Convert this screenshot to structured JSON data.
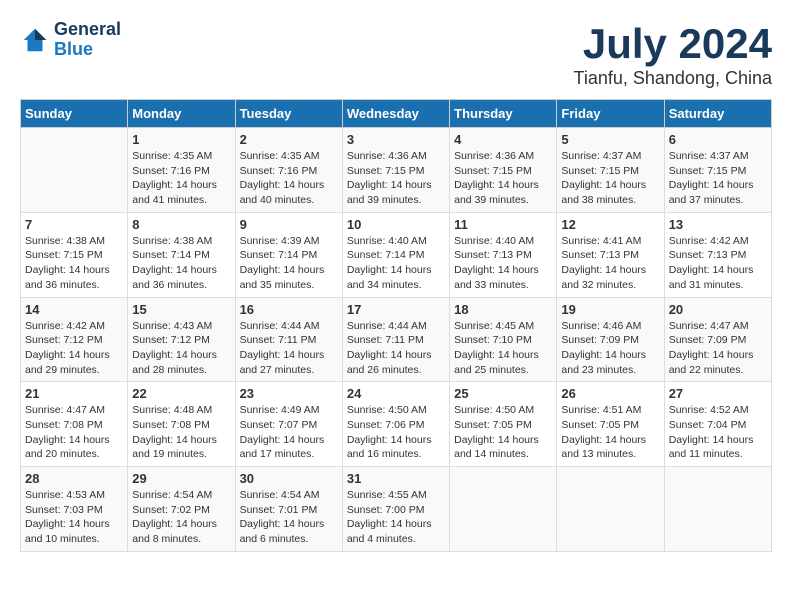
{
  "header": {
    "logo_line1": "General",
    "logo_line2": "Blue",
    "title": "July 2024",
    "subtitle": "Tianfu, Shandong, China"
  },
  "days_of_week": [
    "Sunday",
    "Monday",
    "Tuesday",
    "Wednesday",
    "Thursday",
    "Friday",
    "Saturday"
  ],
  "weeks": [
    [
      {
        "day": "",
        "info": ""
      },
      {
        "day": "1",
        "info": "Sunrise: 4:35 AM\nSunset: 7:16 PM\nDaylight: 14 hours\nand 41 minutes."
      },
      {
        "day": "2",
        "info": "Sunrise: 4:35 AM\nSunset: 7:16 PM\nDaylight: 14 hours\nand 40 minutes."
      },
      {
        "day": "3",
        "info": "Sunrise: 4:36 AM\nSunset: 7:15 PM\nDaylight: 14 hours\nand 39 minutes."
      },
      {
        "day": "4",
        "info": "Sunrise: 4:36 AM\nSunset: 7:15 PM\nDaylight: 14 hours\nand 39 minutes."
      },
      {
        "day": "5",
        "info": "Sunrise: 4:37 AM\nSunset: 7:15 PM\nDaylight: 14 hours\nand 38 minutes."
      },
      {
        "day": "6",
        "info": "Sunrise: 4:37 AM\nSunset: 7:15 PM\nDaylight: 14 hours\nand 37 minutes."
      }
    ],
    [
      {
        "day": "7",
        "info": "Sunrise: 4:38 AM\nSunset: 7:15 PM\nDaylight: 14 hours\nand 36 minutes."
      },
      {
        "day": "8",
        "info": "Sunrise: 4:38 AM\nSunset: 7:14 PM\nDaylight: 14 hours\nand 36 minutes."
      },
      {
        "day": "9",
        "info": "Sunrise: 4:39 AM\nSunset: 7:14 PM\nDaylight: 14 hours\nand 35 minutes."
      },
      {
        "day": "10",
        "info": "Sunrise: 4:40 AM\nSunset: 7:14 PM\nDaylight: 14 hours\nand 34 minutes."
      },
      {
        "day": "11",
        "info": "Sunrise: 4:40 AM\nSunset: 7:13 PM\nDaylight: 14 hours\nand 33 minutes."
      },
      {
        "day": "12",
        "info": "Sunrise: 4:41 AM\nSunset: 7:13 PM\nDaylight: 14 hours\nand 32 minutes."
      },
      {
        "day": "13",
        "info": "Sunrise: 4:42 AM\nSunset: 7:13 PM\nDaylight: 14 hours\nand 31 minutes."
      }
    ],
    [
      {
        "day": "14",
        "info": "Sunrise: 4:42 AM\nSunset: 7:12 PM\nDaylight: 14 hours\nand 29 minutes."
      },
      {
        "day": "15",
        "info": "Sunrise: 4:43 AM\nSunset: 7:12 PM\nDaylight: 14 hours\nand 28 minutes."
      },
      {
        "day": "16",
        "info": "Sunrise: 4:44 AM\nSunset: 7:11 PM\nDaylight: 14 hours\nand 27 minutes."
      },
      {
        "day": "17",
        "info": "Sunrise: 4:44 AM\nSunset: 7:11 PM\nDaylight: 14 hours\nand 26 minutes."
      },
      {
        "day": "18",
        "info": "Sunrise: 4:45 AM\nSunset: 7:10 PM\nDaylight: 14 hours\nand 25 minutes."
      },
      {
        "day": "19",
        "info": "Sunrise: 4:46 AM\nSunset: 7:09 PM\nDaylight: 14 hours\nand 23 minutes."
      },
      {
        "day": "20",
        "info": "Sunrise: 4:47 AM\nSunset: 7:09 PM\nDaylight: 14 hours\nand 22 minutes."
      }
    ],
    [
      {
        "day": "21",
        "info": "Sunrise: 4:47 AM\nSunset: 7:08 PM\nDaylight: 14 hours\nand 20 minutes."
      },
      {
        "day": "22",
        "info": "Sunrise: 4:48 AM\nSunset: 7:08 PM\nDaylight: 14 hours\nand 19 minutes."
      },
      {
        "day": "23",
        "info": "Sunrise: 4:49 AM\nSunset: 7:07 PM\nDaylight: 14 hours\nand 17 minutes."
      },
      {
        "day": "24",
        "info": "Sunrise: 4:50 AM\nSunset: 7:06 PM\nDaylight: 14 hours\nand 16 minutes."
      },
      {
        "day": "25",
        "info": "Sunrise: 4:50 AM\nSunset: 7:05 PM\nDaylight: 14 hours\nand 14 minutes."
      },
      {
        "day": "26",
        "info": "Sunrise: 4:51 AM\nSunset: 7:05 PM\nDaylight: 14 hours\nand 13 minutes."
      },
      {
        "day": "27",
        "info": "Sunrise: 4:52 AM\nSunset: 7:04 PM\nDaylight: 14 hours\nand 11 minutes."
      }
    ],
    [
      {
        "day": "28",
        "info": "Sunrise: 4:53 AM\nSunset: 7:03 PM\nDaylight: 14 hours\nand 10 minutes."
      },
      {
        "day": "29",
        "info": "Sunrise: 4:54 AM\nSunset: 7:02 PM\nDaylight: 14 hours\nand 8 minutes."
      },
      {
        "day": "30",
        "info": "Sunrise: 4:54 AM\nSunset: 7:01 PM\nDaylight: 14 hours\nand 6 minutes."
      },
      {
        "day": "31",
        "info": "Sunrise: 4:55 AM\nSunset: 7:00 PM\nDaylight: 14 hours\nand 4 minutes."
      },
      {
        "day": "",
        "info": ""
      },
      {
        "day": "",
        "info": ""
      },
      {
        "day": "",
        "info": ""
      }
    ]
  ]
}
